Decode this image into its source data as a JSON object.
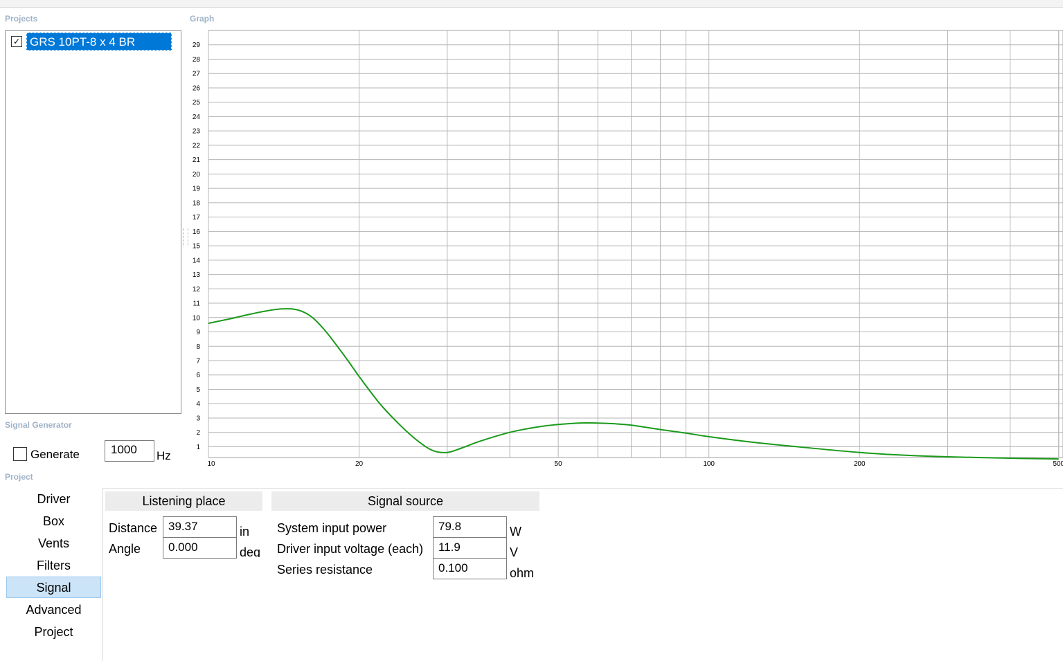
{
  "sections": {
    "projects": "Projects",
    "graph": "Graph",
    "signal_generator": "Signal Generator",
    "project": "Project"
  },
  "projects": [
    {
      "name": "GRS 10PT-8 x 4 BR",
      "checked": true,
      "selected": true
    }
  ],
  "signal_generator": {
    "generate_label": "Generate",
    "generate_checked": false,
    "frequency_value": "1000",
    "frequency_unit": "Hz"
  },
  "nav": {
    "items": [
      "Driver",
      "Box",
      "Vents",
      "Filters",
      "Signal",
      "Advanced",
      "Project"
    ],
    "active": "Signal"
  },
  "listening_place": {
    "title": "Listening place",
    "distance_label": "Distance",
    "distance_value": "39.37",
    "distance_unit": "in",
    "angle_label": "Angle",
    "angle_value": "0.000",
    "angle_unit": "deg"
  },
  "signal_source": {
    "title": "Signal source",
    "power_label": "System input power",
    "power_value": "79.8",
    "power_unit": "W",
    "voltage_label": "Driver input voltage (each)",
    "voltage_value": "11.9",
    "voltage_unit": "V",
    "resistance_label": "Series resistance",
    "resistance_value": "0.100",
    "resistance_unit": "ohm"
  },
  "chart_data": {
    "type": "line",
    "x_scale": "log",
    "xlim": [
      10,
      510
    ],
    "ylim": [
      0.25,
      30
    ],
    "x_tick_labels": [
      "10",
      "20",
      "50",
      "100",
      "200",
      "500"
    ],
    "x_tick_values": [
      10,
      20,
      50,
      100,
      200,
      500
    ],
    "y_tick_labels": [
      "1",
      "2",
      "3",
      "4",
      "5",
      "6",
      "7",
      "8",
      "9",
      "10",
      "11",
      "12",
      "13",
      "14",
      "15",
      "16",
      "17",
      "18",
      "19",
      "20",
      "21",
      "22",
      "23",
      "24",
      "25",
      "26",
      "27",
      "28",
      "29"
    ],
    "grid": true,
    "series": [
      {
        "color": "#1a9a1a",
        "x": [
          10,
          11,
          12,
          13,
          14,
          15,
          16,
          17,
          18,
          19,
          20,
          22,
          24,
          26,
          28,
          30,
          32,
          35,
          40,
          45,
          50,
          55,
          60,
          65,
          70,
          80,
          90,
          100,
          120,
          150,
          200,
          250,
          300,
          400,
          500
        ],
        "y": [
          9.6,
          9.9,
          10.2,
          10.45,
          10.6,
          10.55,
          10.1,
          9.2,
          8.1,
          7.0,
          5.9,
          4.0,
          2.6,
          1.5,
          0.75,
          0.6,
          0.9,
          1.4,
          2.0,
          2.35,
          2.55,
          2.65,
          2.65,
          2.6,
          2.5,
          2.2,
          1.95,
          1.7,
          1.35,
          1.0,
          0.6,
          0.4,
          0.3,
          0.2,
          0.15
        ]
      }
    ]
  }
}
